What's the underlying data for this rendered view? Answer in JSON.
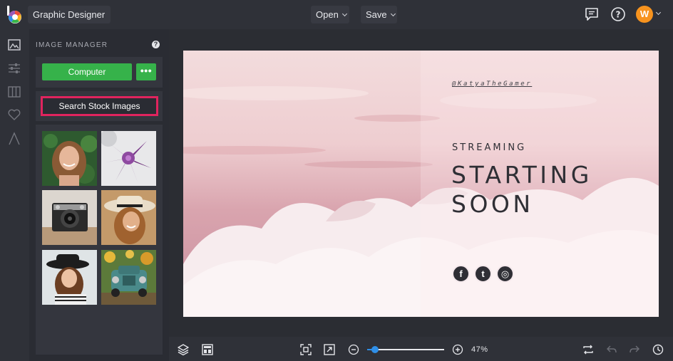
{
  "header": {
    "app_title": "Graphic Designer",
    "open_label": "Open",
    "save_label": "Save",
    "user_initial": "W"
  },
  "sidebar": {
    "rail_icons": [
      "image-icon",
      "sliders-icon",
      "columns-icon",
      "heart-icon",
      "text-icon"
    ]
  },
  "panel": {
    "title": "IMAGE MANAGER",
    "help_label": "?",
    "computer_label": "Computer",
    "more_label": "•••",
    "stock_label": "Search Stock Images",
    "thumbnails": [
      "woman-portrait",
      "purple-succulent",
      "vintage-camera",
      "woman-hat-smiling",
      "woman-black-hat",
      "old-teal-truck"
    ]
  },
  "design": {
    "handle": "@KatyaTheGamer",
    "kicker": "STREAMING",
    "headline_line1": "STARTING",
    "headline_line2": "SOON",
    "social": [
      "facebook-icon",
      "tumblr-icon",
      "instagram-icon"
    ],
    "social_letters": [
      "f",
      "t",
      "◎"
    ]
  },
  "bottom": {
    "zoom_text": "47%",
    "zoom_level": 0.1
  },
  "colors": {
    "accent_green": "#36b24a",
    "highlight_pink": "#e0245e",
    "avatar_orange": "#f7931e",
    "zoom_blue": "#2f8fe8"
  }
}
